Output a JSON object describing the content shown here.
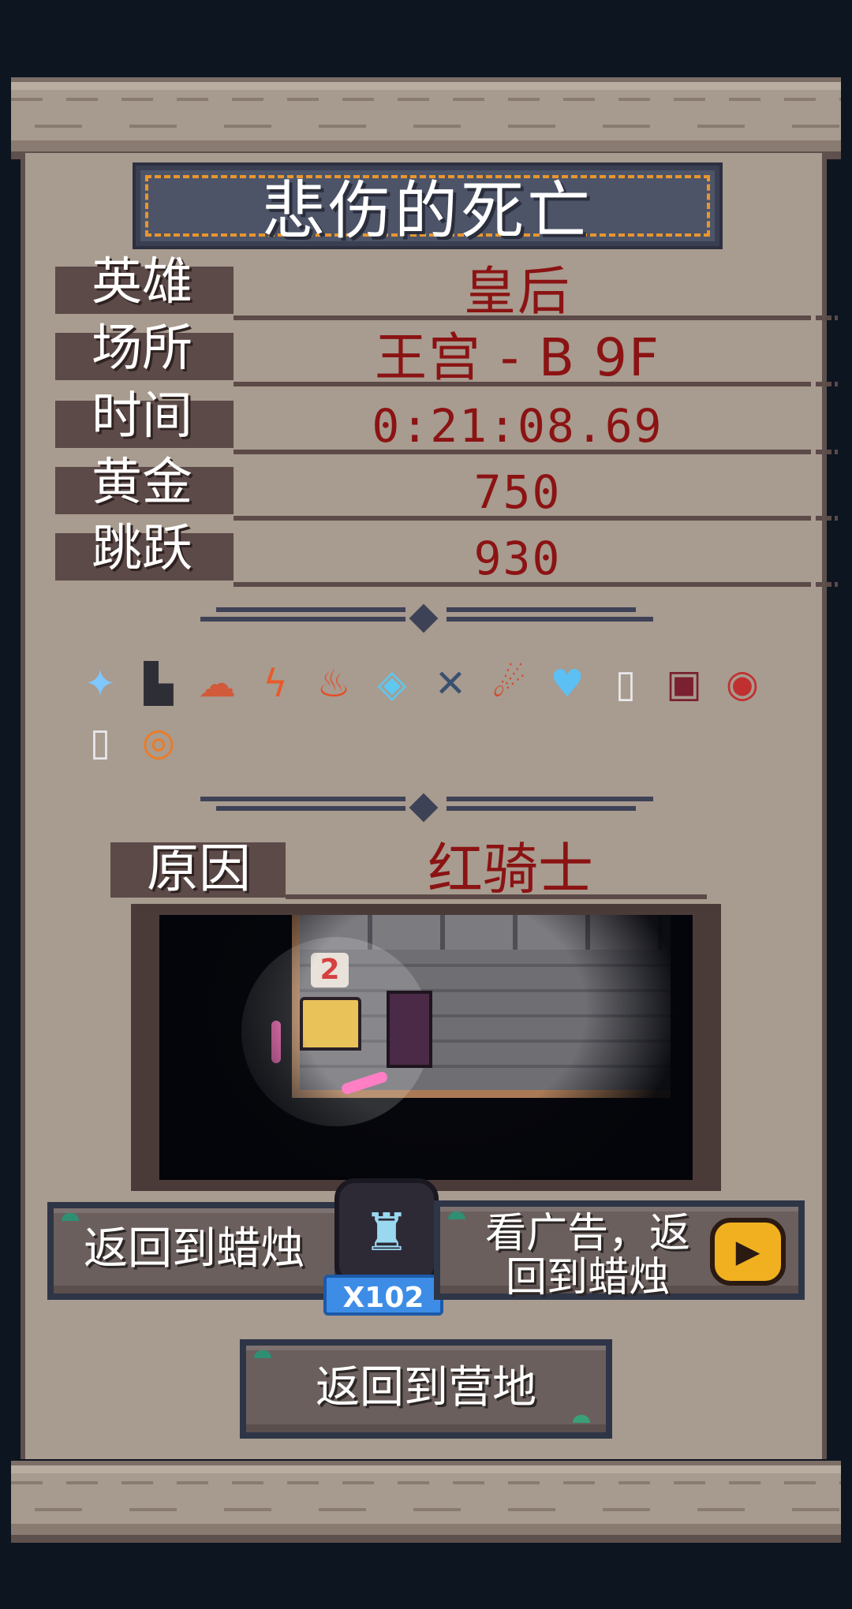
{
  "title": "悲伤的死亡",
  "stats": [
    {
      "label": "英雄",
      "value": "皇后"
    },
    {
      "label": "场所",
      "value": "王宫 - B 9F"
    },
    {
      "label": "时间",
      "value": "0:21:08.69"
    },
    {
      "label": "黄金",
      "value": "750"
    },
    {
      "label": "跳跃",
      "value": "930"
    }
  ],
  "items": [
    {
      "name": "star-item-icon",
      "glyph": "✦",
      "color": "#7fc7ff"
    },
    {
      "name": "boot-item-icon",
      "glyph": "▙",
      "color": "#2e2e36"
    },
    {
      "name": "mushroom-cloud-item-icon",
      "glyph": "☁",
      "color": "#d05a3a"
    },
    {
      "name": "lightning-item-icon",
      "glyph": "ϟ",
      "color": "#e85a2a"
    },
    {
      "name": "fire-item-icon",
      "glyph": "♨",
      "color": "#e84a24"
    },
    {
      "name": "ice-cube-item-icon",
      "glyph": "◈",
      "color": "#5ec8f0"
    },
    {
      "name": "crossed-swords-item-icon",
      "glyph": "✕",
      "color": "#3a5070"
    },
    {
      "name": "meteor-item-icon",
      "glyph": "☄",
      "color": "#d04a2a"
    },
    {
      "name": "heart-item-icon",
      "glyph": "♥",
      "color": "#5cc0f4"
    },
    {
      "name": "milk-bottle-item-icon",
      "glyph": "▯",
      "color": "#e8e8ec"
    },
    {
      "name": "dark-chest-item-icon",
      "glyph": "▣",
      "color": "#7a2030"
    },
    {
      "name": "red-orb-item-icon",
      "glyph": "◉",
      "color": "#c03030"
    },
    {
      "name": "milk-bottle-item-icon-2",
      "glyph": "▯",
      "color": "#e8e8ec"
    },
    {
      "name": "fire-ring-item-icon",
      "glyph": "◎",
      "color": "#f07a20"
    }
  ],
  "cause": {
    "label": "原因",
    "value": "红骑士"
  },
  "screenshot": {
    "damage_number": "2"
  },
  "buttons": {
    "return_candle": "返回到蜡烛",
    "candle_count": "X102",
    "watch_ad_line1": "看广告，返",
    "watch_ad_line2": "回到蜡烛",
    "return_camp": "返回到营地"
  }
}
